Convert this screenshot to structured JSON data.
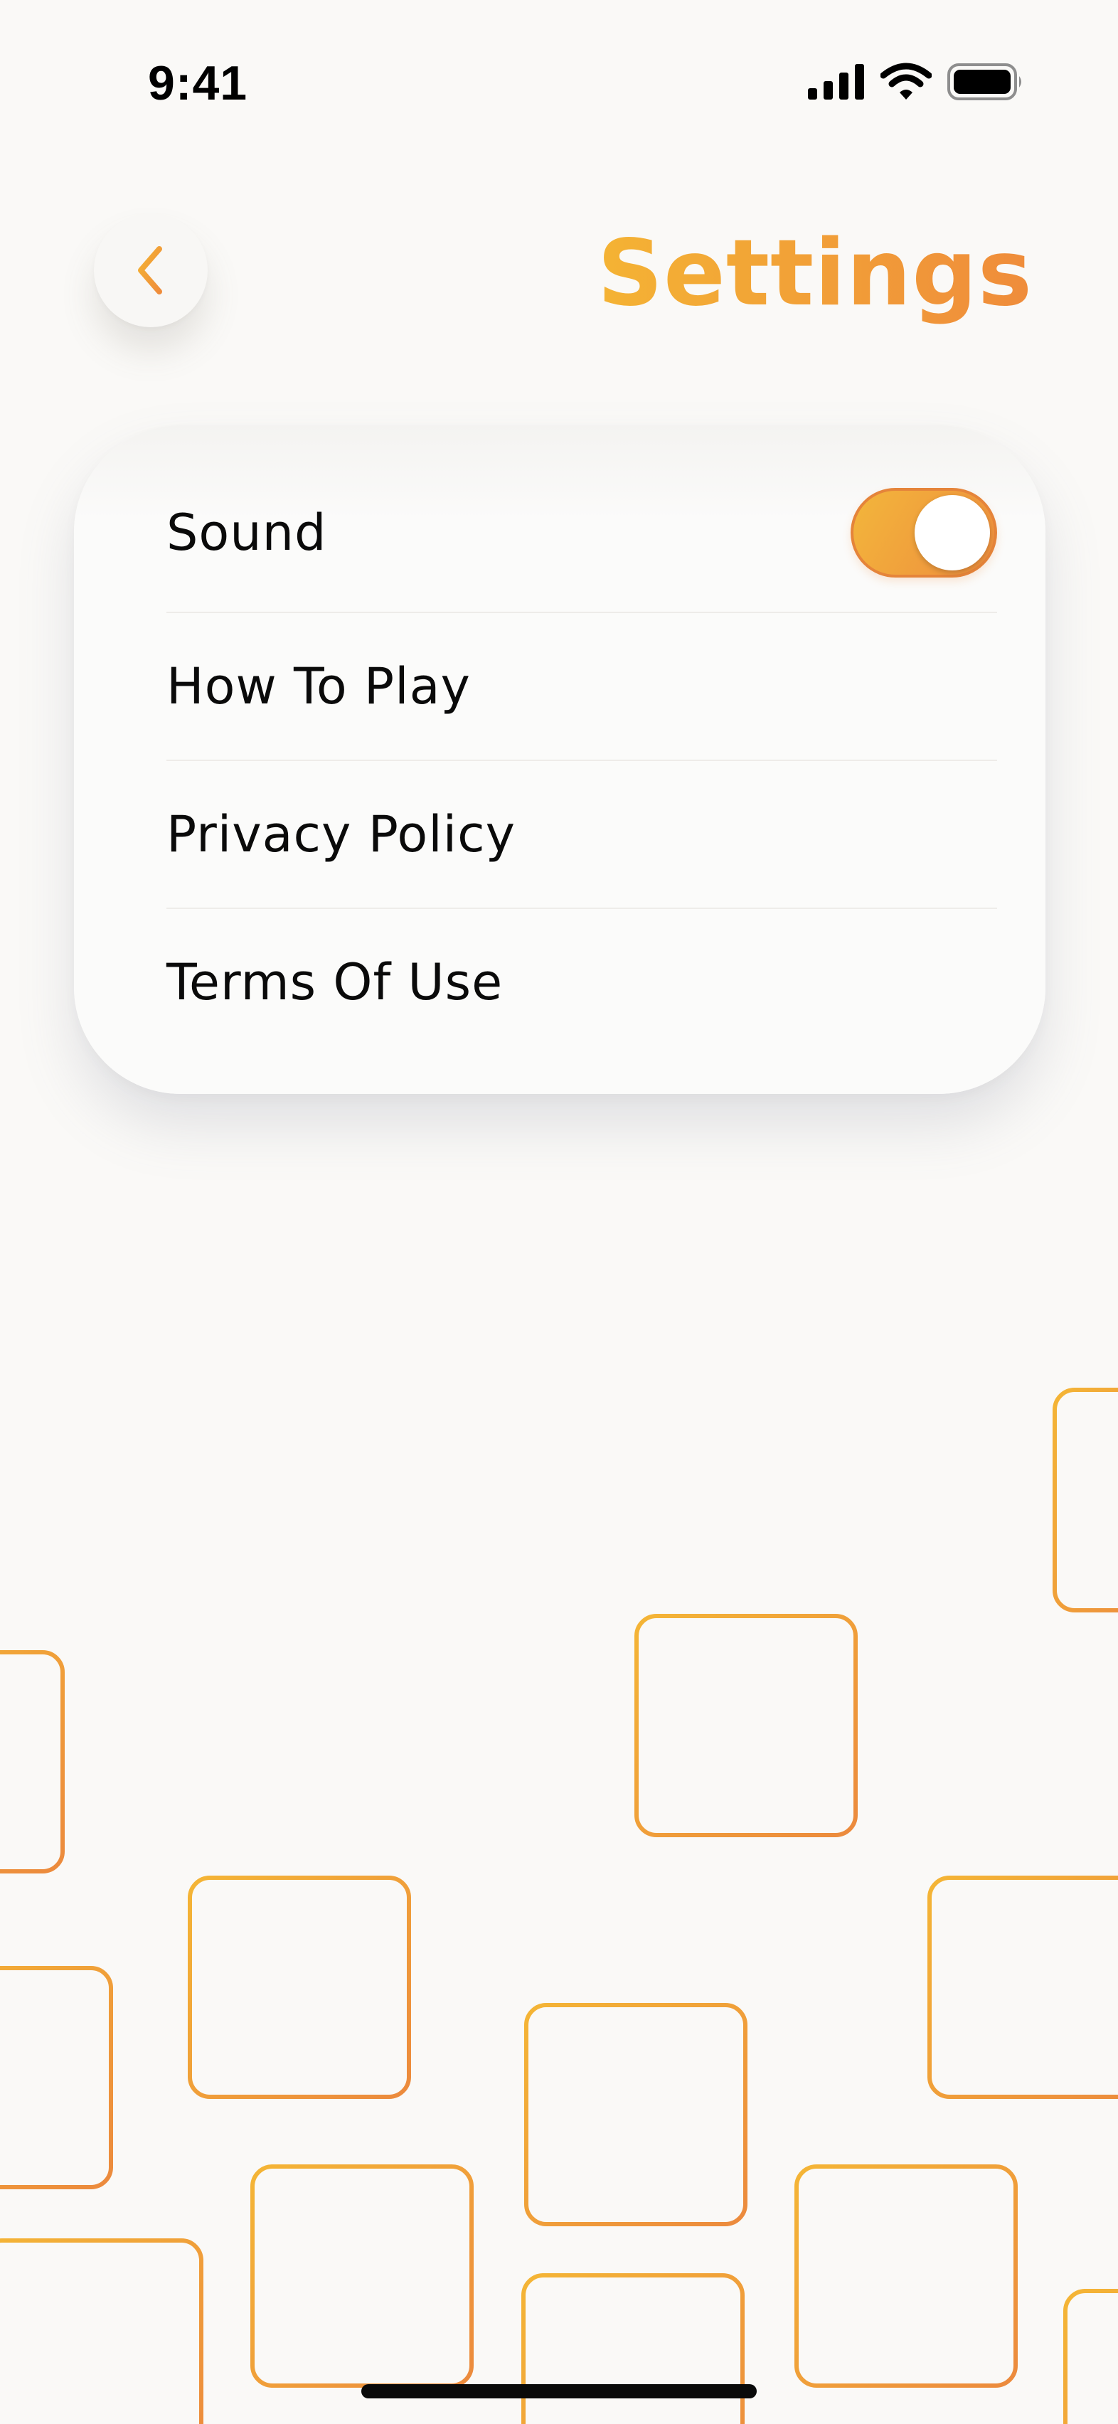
{
  "status_bar": {
    "time": "9:41",
    "icons": [
      "cellular-signal-icon",
      "wifi-icon",
      "battery-icon"
    ]
  },
  "header": {
    "back_icon": "chevron-left-icon",
    "title": "Settings"
  },
  "settings": {
    "sound": {
      "label": "Sound",
      "enabled": true
    },
    "items": [
      {
        "label": "How To Play"
      },
      {
        "label": "Privacy Policy"
      },
      {
        "label": "Terms Of Use"
      }
    ]
  },
  "colors": {
    "background": "#faf9f7",
    "accent_start": "#f4b334",
    "accent_end": "#ef8c3b",
    "text": "#0a0a0a"
  },
  "decoration": {
    "pattern": "outlined-rounded-squares"
  }
}
